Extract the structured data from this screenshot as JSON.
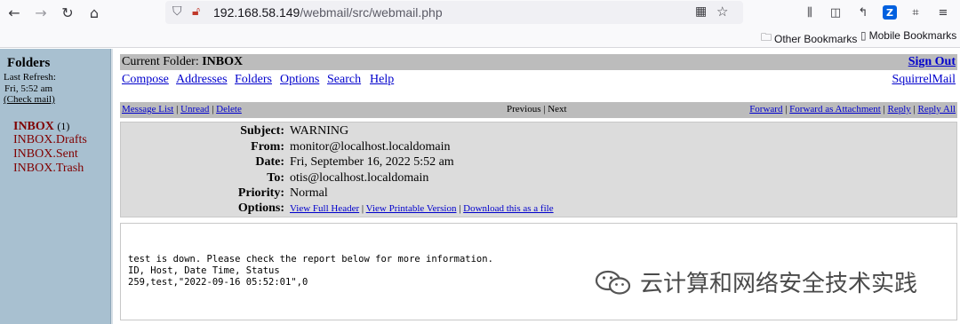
{
  "browser": {
    "url_host": "192.168.58.149",
    "url_path": "/webmail/src/webmail.php",
    "bookmarks": [
      {
        "label": "Other Bookmarks",
        "icon": "folder-icon"
      },
      {
        "label": "Mobile Bookmarks",
        "icon": "mobile-icon"
      }
    ]
  },
  "left_pane": {
    "title": "Folders",
    "last_refresh_label": "Last Refresh:",
    "last_refresh_time": "Fri, 5:52 am",
    "check_mail": "(Check mail)",
    "folders": [
      {
        "name": "INBOX",
        "count": "(1)"
      },
      {
        "name": "INBOX.Drafts"
      },
      {
        "name": "INBOX.Sent"
      },
      {
        "name": "INBOX.Trash"
      }
    ]
  },
  "main": {
    "current_folder_label": "Current Folder:",
    "current_folder": "INBOX",
    "sign_out": "Sign Out",
    "menu": [
      "Compose",
      "Addresses",
      "Folders",
      "Options",
      "Search",
      "Help"
    ],
    "brand": "SquirrelMail",
    "nav_left": [
      "Message List",
      "Unread",
      "Delete"
    ],
    "nav_mid": [
      "Previous",
      "Next"
    ],
    "nav_right": [
      "Forward",
      "Forward as Attachment",
      "Reply",
      "Reply All"
    ]
  },
  "message": {
    "labels": {
      "subject": "Subject:",
      "from": "From:",
      "date": "Date:",
      "to": "To:",
      "priority": "Priority:",
      "options": "Options:"
    },
    "subject": "WARNING",
    "from": "monitor@localhost.localdomain",
    "date": "Fri, September 16, 2022 5:52 am",
    "to": "otis@localhost.localdomain",
    "priority": "Normal",
    "options": [
      "View Full Header",
      "View Printable Version",
      "Download this as a file"
    ],
    "body_lines": [
      "test is down. Please check the report below for more information.",
      "",
      "ID, Host, Date Time, Status",
      "259,test,\"2022-09-16 05:52:01\",0"
    ]
  },
  "watermark": {
    "text": "云计算和网络安全技术实践"
  }
}
